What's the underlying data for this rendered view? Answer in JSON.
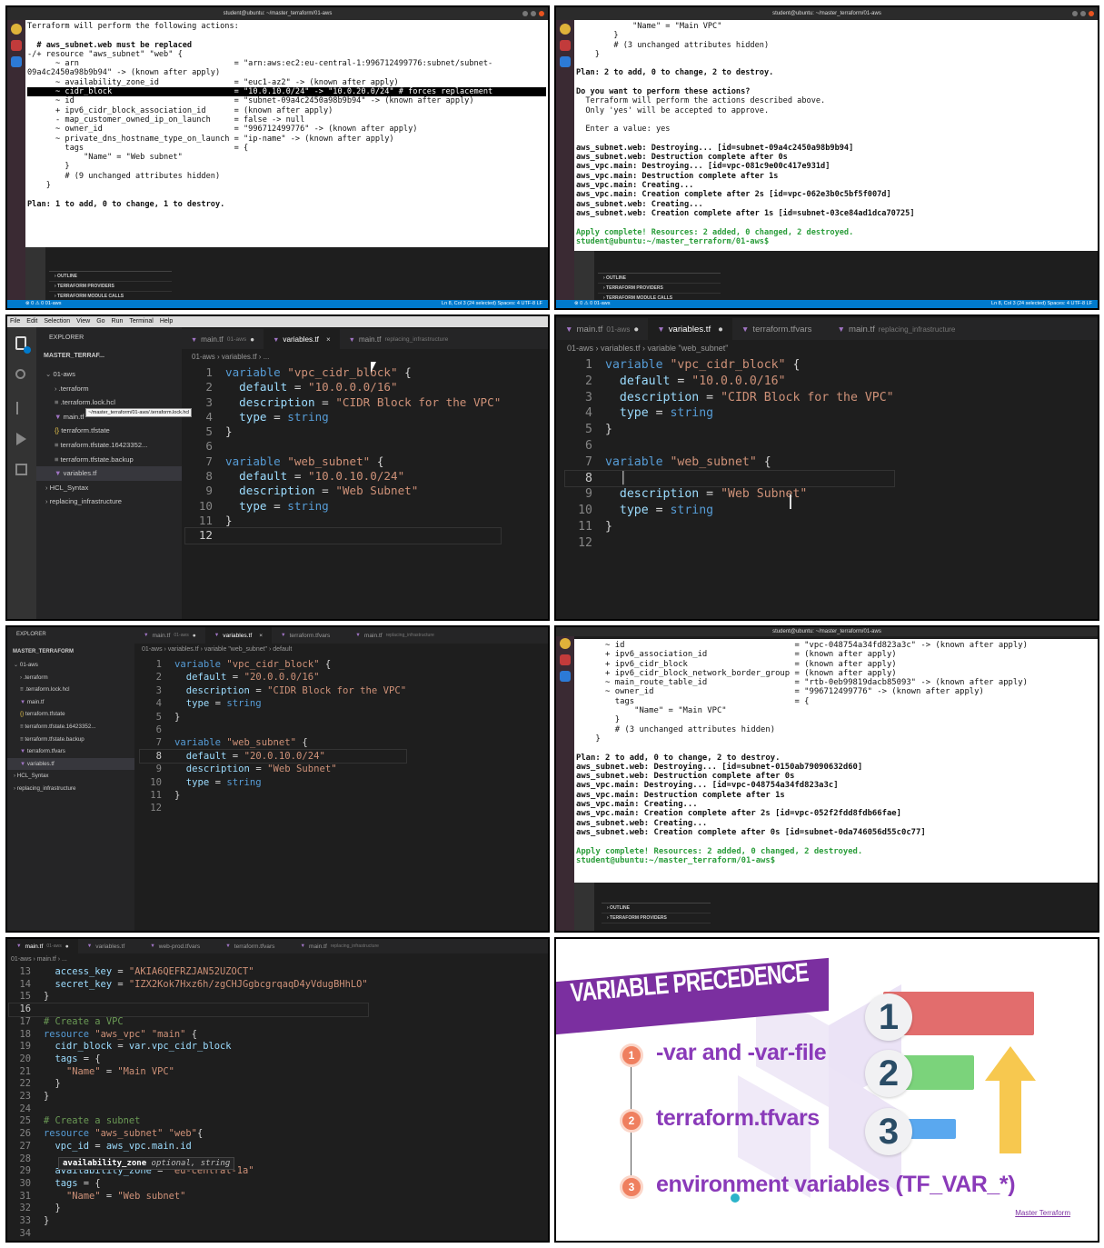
{
  "panels": {
    "p1": {
      "window_title": "student@ubuntu: ~/master_terraform/01-aws",
      "lines": [
        "Terraform will perform the following actions:",
        "",
        "  # aws_subnet.web must be replaced",
        "-/+ resource \"aws_subnet\" \"web\" {",
        "      ~ arn                                 = \"arn:aws:ec2:eu-central-1:996712499776:subnet/subnet-",
        "09a4c2450a98b9b94\" -> (known after apply)",
        "      ~ availability_zone_id                = \"euc1-az2\" -> (known after apply)",
        "      ~ cidr_block                          = \"10.0.10.0/24\" -> \"10.0.20.0/24\" # forces replacement",
        "      ~ id                                  = \"subnet-09a4c2450a98b9b94\" -> (known after apply)",
        "      + ipv6_cidr_block_association_id      = (known after apply)",
        "      - map_customer_owned_ip_on_launch     = false -> null",
        "      ~ owner_id                            = \"996712499776\" -> (known after apply)",
        "      ~ private_dns_hostname_type_on_launch = \"ip-name\" -> (known after apply)",
        "        tags                                = {",
        "            \"Name\" = \"Web subnet\"",
        "        }",
        "        # (9 unchanged attributes hidden)",
        "    }",
        "",
        "Plan: 1 to add, 0 to change, 1 to destroy."
      ],
      "outline": [
        "OUTLINE",
        "TERRAFORM PROVIDERS",
        "TERRAFORM MODULE CALLS"
      ],
      "status_left": "⊗ 0 ⚠ 0   01-aws",
      "status_right": "Ln 8, Col 3 (24 selected)   Spaces: 4   UTF-8   LF"
    },
    "p2": {
      "window_title": "student@ubuntu: ~/master_terraform/01-aws",
      "lines": [
        "            \"Name\" = \"Main VPC\"",
        "        }",
        "        # (3 unchanged attributes hidden)",
        "    }",
        "",
        "Plan: 2 to add, 0 to change, 2 to destroy.",
        "",
        "Do you want to perform these actions?",
        "  Terraform will perform the actions described above.",
        "  Only 'yes' will be accepted to approve.",
        "",
        "  Enter a value: yes",
        "",
        "aws_subnet.web: Destroying... [id=subnet-09a4c2450a98b9b94]",
        "aws_subnet.web: Destruction complete after 0s",
        "aws_vpc.main: Destroying... [id=vpc-081c9e00c417e931d]",
        "aws_vpc.main: Destruction complete after 1s",
        "aws_vpc.main: Creating...",
        "aws_vpc.main: Creation complete after 2s [id=vpc-062e3b0c5bf5f007d]",
        "aws_subnet.web: Creating...",
        "aws_subnet.web: Creation complete after 1s [id=subnet-03ce84ad1dca70725]",
        "",
        "Apply complete! Resources: 2 added, 0 changed, 2 destroyed.",
        "student@ubuntu:~/master_terraform/01-aws$ "
      ],
      "outline": [
        "OUTLINE",
        "TERRAFORM PROVIDERS",
        "TERRAFORM MODULE CALLS"
      ],
      "status_left": "⊗ 0 ⚠ 0   01-aws",
      "status_right": "Ln 8, Col 3 (24 selected)   Spaces: 4   UTF-8   LF"
    },
    "p3": {
      "menu": [
        "File",
        "Edit",
        "Selection",
        "View",
        "Go",
        "Run",
        "Terminal",
        "Help"
      ],
      "explorer_title": "EXPLORER",
      "root": "MASTER_TERRAF...",
      "tree": [
        {
          "label": "01-aws",
          "glyph": "⌄",
          "indent": 1
        },
        {
          "label": ".terraform",
          "glyph": "›",
          "indent": 2
        },
        {
          "label": ".terraform.lock.hcl",
          "glyph": "≡",
          "indent": 2
        },
        {
          "label": "main.tf",
          "glyph": "▼",
          "indent": 2
        },
        {
          "label": "terraform.tfstate",
          "glyph": "{}",
          "indent": 2
        },
        {
          "label": "terraform.tfstate.16423352...",
          "glyph": "≡",
          "indent": 2
        },
        {
          "label": "terraform.tfstate.backup",
          "glyph": "≡",
          "indent": 2
        },
        {
          "label": "variables.tf",
          "glyph": "▼",
          "indent": 2
        },
        {
          "label": "HCL_Syntax",
          "glyph": "›",
          "indent": 1
        },
        {
          "label": "replacing_infrastructure",
          "glyph": "›",
          "indent": 1
        }
      ],
      "tooltip": "~/master_terraform/01-aws/.terraform.lock.hcl",
      "tabs": [
        {
          "label": "main.tf",
          "desc": "01-aws",
          "mark": "●"
        },
        {
          "label": "variables.tf",
          "desc": "",
          "mark": "×"
        },
        {
          "label": "main.tf",
          "desc": "replacing_infrastructure",
          "mark": ""
        }
      ],
      "breadcrumb": "01-aws  ›  variables.tf  ›  ..."
    },
    "p4": {
      "tabs": [
        {
          "label": "main.tf",
          "desc": "01-aws",
          "mark": "●"
        },
        {
          "label": "variables.tf",
          "desc": "",
          "mark": "●"
        },
        {
          "label": "terraform.tfvars",
          "desc": "",
          "mark": ""
        },
        {
          "label": "main.tf",
          "desc": "replacing_infrastructure",
          "mark": ""
        }
      ],
      "breadcrumb": "01-aws  ›  variables.tf  ›  variable \"web_subnet\""
    },
    "p5": {
      "explorer_title": "EXPLORER",
      "root": "MASTER_TERRAFORM",
      "tree": [
        {
          "label": "01-aws",
          "glyph": "⌄",
          "indent": 1
        },
        {
          "label": ".terraform",
          "glyph": "›",
          "indent": 2
        },
        {
          "label": ".terraform.lock.hcl",
          "glyph": "≡",
          "indent": 2
        },
        {
          "label": "main.tf",
          "glyph": "▼",
          "indent": 2
        },
        {
          "label": "terraform.tfstate",
          "glyph": "{}",
          "indent": 2
        },
        {
          "label": "terraform.tfstate.16423352...",
          "glyph": "≡",
          "indent": 2
        },
        {
          "label": "terraform.tfstate.backup",
          "glyph": "≡",
          "indent": 2
        },
        {
          "label": "terraform.tfvars",
          "glyph": "▼",
          "indent": 2
        },
        {
          "label": "variables.tf",
          "glyph": "▼",
          "indent": 2
        },
        {
          "label": "HCL_Syntax",
          "glyph": "›",
          "indent": 1
        },
        {
          "label": "replacing_infrastructure",
          "glyph": "›",
          "indent": 1
        }
      ],
      "tabs": [
        {
          "label": "main.tf",
          "desc": "01-aws",
          "mark": "●"
        },
        {
          "label": "variables.tf",
          "desc": "",
          "mark": "×"
        },
        {
          "label": "terraform.tfvars",
          "desc": "",
          "mark": ""
        },
        {
          "label": "main.tf",
          "desc": "replacing_infrastructure",
          "mark": ""
        }
      ],
      "breadcrumb": "01-aws  ›  variables.tf  ›  variable \"web_subnet\"  ›  default"
    },
    "p6": {
      "window_title": "student@ubuntu: ~/master_terraform/01-aws",
      "lines": [
        "      ~ id                                   = \"vpc-048754a34fd823a3c\" -> (known after apply)",
        "      + ipv6_association_id                  = (known after apply)",
        "      + ipv6_cidr_block                      = (known after apply)",
        "      + ipv6_cidr_block_network_border_group = (known after apply)",
        "      ~ main_route_table_id                  = \"rtb-0eb99819dacb85093\" -> (known after apply)",
        "      ~ owner_id                             = \"996712499776\" -> (known after apply)",
        "        tags                                 = {",
        "            \"Name\" = \"Main VPC\"",
        "        }",
        "        # (3 unchanged attributes hidden)",
        "    }",
        "",
        "Plan: 2 to add, 0 to change, 2 to destroy.",
        "aws_subnet.web: Destroying... [id=subnet-0150ab79090632d60]",
        "aws_subnet.web: Destruction complete after 0s",
        "aws_vpc.main: Destroying... [id=vpc-048754a34fd823a3c]",
        "aws_vpc.main: Destruction complete after 1s",
        "aws_vpc.main: Creating...",
        "aws_vpc.main: Creation complete after 2s [id=vpc-052f2fdd8fdb66fae]",
        "aws_subnet.web: Creating...",
        "aws_subnet.web: Creation complete after 0s [id=subnet-0da746056d55c0c77]",
        "",
        "Apply complete! Resources: 2 added, 0 changed, 2 destroyed.",
        "student@ubuntu:~/master_terraform/01-aws$ "
      ],
      "outline": [
        "OUTLINE",
        "TERRAFORM PROVIDERS"
      ]
    },
    "p7": {
      "tabs": [
        {
          "label": "main.tf",
          "desc": "01-aws",
          "mark": "●"
        },
        {
          "label": "variables.tf",
          "desc": "",
          "mark": ""
        },
        {
          "label": "web-prod.tfvars",
          "desc": "",
          "mark": ""
        },
        {
          "label": "terraform.tfvars",
          "desc": "",
          "mark": ""
        },
        {
          "label": "main.tf",
          "desc": "replacing_infrastructure",
          "mark": ""
        }
      ],
      "breadcrumb": "01-aws  ›  main.tf  ›  ...",
      "hover": "availability_zone",
      "hover_hint": " optional, string"
    },
    "p8": {
      "title": "VARIABLE PRECEDENCE",
      "items": [
        {
          "num": "1",
          "text": "-var and -var-file"
        },
        {
          "num": "2",
          "text": "terraform.tfvars"
        },
        {
          "num": "3",
          "text": "environment variables (TF_VAR_*)"
        }
      ],
      "ranks": [
        "1",
        "2",
        "3"
      ],
      "brand": "Master Terraform",
      "colors": {
        "banner": "#7b2fa0",
        "text": "#8a3ab9",
        "bullet": "#ef7f5f",
        "bar1": "#e26d6d",
        "bar2": "#7bd37b",
        "bar3": "#5aa8ef",
        "arrow": "#f7c84f"
      }
    }
  }
}
